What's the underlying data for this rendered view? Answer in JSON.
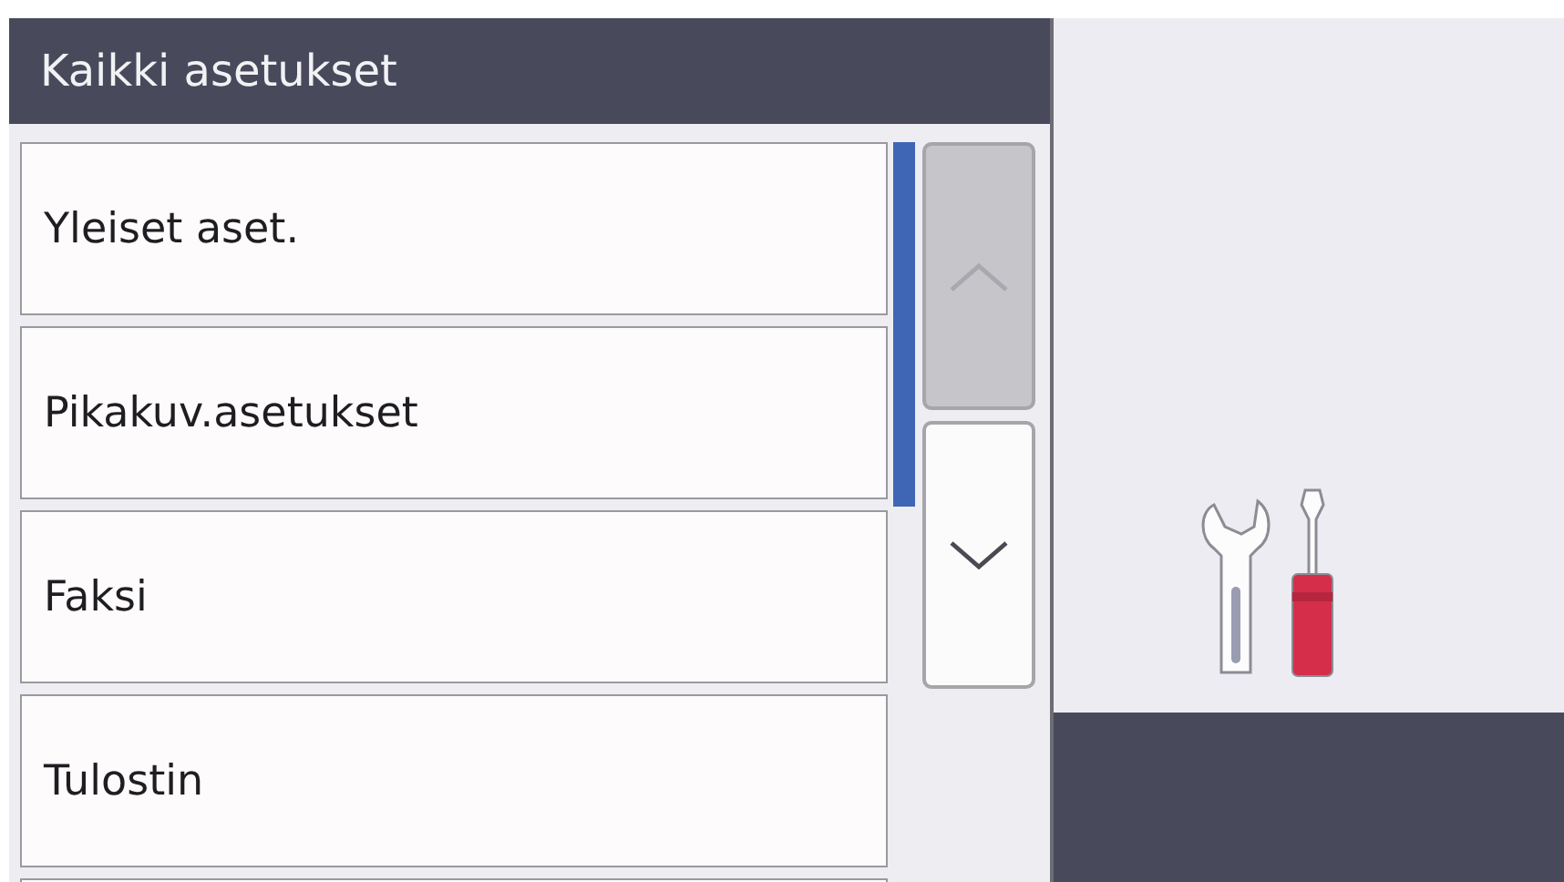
{
  "header": {
    "title": "Kaikki asetukset"
  },
  "menu_items": [
    {
      "label": "Yleiset aset."
    },
    {
      "label": "Pikakuv.asetukset"
    },
    {
      "label": "Faksi"
    },
    {
      "label": "Tulostin"
    }
  ],
  "scroll_buttons": [
    {
      "kind": "up",
      "disabled": true
    },
    {
      "kind": "down",
      "disabled": false
    }
  ]
}
